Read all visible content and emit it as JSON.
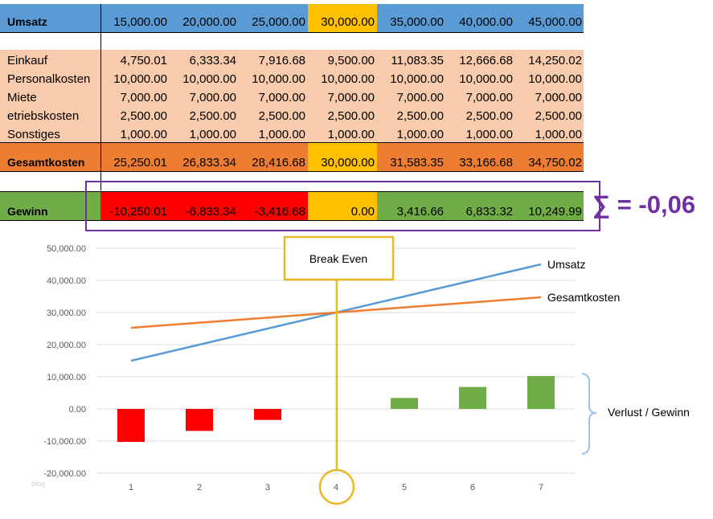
{
  "table": {
    "umsatz": {
      "label": "Umsatz",
      "values": [
        "15,000.00",
        "20,000.00",
        "25,000.00",
        "30,000.00",
        "35,000.00",
        "40,000.00",
        "45,000.00"
      ]
    },
    "cost_rows": [
      {
        "label": "Einkauf",
        "values": [
          "4,750.01",
          "6,333.34",
          "7,916.68",
          "9,500.00",
          "11,083.35",
          "12,666.68",
          "14,250.02"
        ]
      },
      {
        "label": "Personalkosten",
        "values": [
          "10,000.00",
          "10,000.00",
          "10,000.00",
          "10,000.00",
          "10,000.00",
          "10,000.00",
          "10,000.00"
        ]
      },
      {
        "label": "Miete",
        "values": [
          "7,000.00",
          "7,000.00",
          "7,000.00",
          "7,000.00",
          "7,000.00",
          "7,000.00",
          "7,000.00"
        ]
      },
      {
        "label": "etriebskosten",
        "values": [
          "2,500.00",
          "2,500.00",
          "2,500.00",
          "2,500.00",
          "2,500.00",
          "2,500.00",
          "2,500.00"
        ]
      },
      {
        "label": "Sonstiges",
        "values": [
          "1,000.00",
          "1,000.00",
          "1,000.00",
          "1,000.00",
          "1,000.00",
          "1,000.00",
          "1,000.00"
        ]
      }
    ],
    "gesamtkosten": {
      "label": "Gesamtkosten",
      "values": [
        "25,250.01",
        "26,833.34",
        "28,416.68",
        "30,000.00",
        "31,583.35",
        "33,166.68",
        "34,750.02"
      ]
    },
    "gewinn": {
      "label": "Gewinn",
      "values": [
        "-10,250.01",
        "-6,833.34",
        "-3,416.68",
        "0.00",
        "3,416.66",
        "6,833.32",
        "10,249.99"
      ]
    }
  },
  "sum_note": "∑ = -0,06",
  "break_even_label": "Break Even",
  "watermark": "blog",
  "colors": {
    "umsatz_row": "#5b9bd5",
    "cost_rows": "#f8cbad",
    "gesamtkosten_row": "#ed7d31",
    "highlight": "#ffc000",
    "loss": "#ff0000",
    "profit": "#70ad47",
    "box_border": "#7030a0",
    "break_even": "#e8b923",
    "brace": "#9dc3e6",
    "umsatz_line": "#5b9bd5",
    "kosten_line": "#ed7d31"
  },
  "chart_data": {
    "type": "line",
    "categories": [
      "1",
      "2",
      "3",
      "4",
      "5",
      "6",
      "7"
    ],
    "ylim": [
      -20000,
      50000
    ],
    "y_ticks": [
      "50,000.00",
      "40,000.00",
      "30,000.00",
      "20,000.00",
      "10,000.00",
      "0.00",
      "-10,000.00",
      "-20,000.00"
    ],
    "grid": true,
    "series": [
      {
        "name": "Umsatz",
        "type": "line",
        "values": [
          15000,
          20000,
          25000,
          30000,
          35000,
          40000,
          45000
        ]
      },
      {
        "name": "Gesamtkosten",
        "type": "line",
        "values": [
          25250.01,
          26833.34,
          28416.68,
          30000,
          31583.35,
          33166.68,
          34750.02
        ]
      },
      {
        "name": "Verlust / Gewinn",
        "type": "bar",
        "values": [
          -10250.01,
          -6833.34,
          -3416.68,
          0,
          3416.66,
          6833.32,
          10249.99
        ]
      }
    ]
  }
}
